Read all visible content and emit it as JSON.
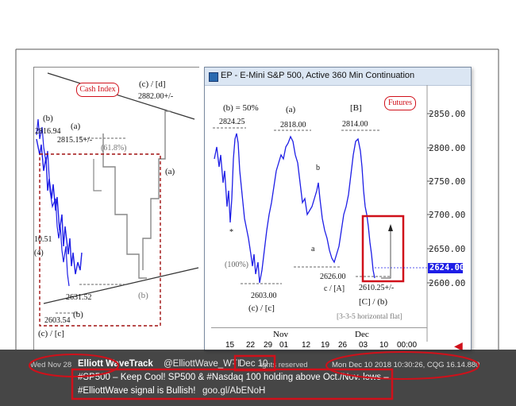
{
  "left_chart": {
    "cash_index_label": "Cash Index",
    "cd_label": "(c) / [d]",
    "cd_value": "2882.00+/-",
    "b_label": "(b)",
    "b_value": "2816.94",
    "a_label": "(a)",
    "a_value": "2815.15+/-",
    "fib_label": "(61.8%)",
    "left_value": "10.51",
    "left_4_label": "(4)",
    "low_value": "2631.52",
    "low_b_label": "(b)",
    "bottom_value": "2603.54",
    "bottom_label": "(c) / [c]",
    "right_b_label": "(b)",
    "right_a_label": "(a)",
    "date_fragment": "Wed Nov 28"
  },
  "window": {
    "title": "EP - E-Mini S&P 500, Active 360 Min Continuation",
    "futures_label": "Futures",
    "annotations": {
      "b50": "(b)  = 50%",
      "b50_value": "2824.25",
      "a": "(a)",
      "a_value": "2818.00",
      "B": "[B]",
      "B_value": "2814.00",
      "b_small": "b",
      "a_small": "a",
      "star": "*",
      "pct100": "(100%)",
      "low1_value": "2603.00",
      "low1_label": "(c) / [c]",
      "mid_value": "2626.00",
      "mid_label": "c / [A]",
      "right_value": "2610.25+/-",
      "right_label": "[C] / (b)",
      "flat_note": "[3-3-5 horizontal flat]"
    },
    "price_axis": [
      "2850.00",
      "2800.00",
      "2750.00",
      "2700.00",
      "2650.00",
      "2600.00"
    ],
    "current_price": "2624.00",
    "month_labels": [
      "Nov",
      "Dec"
    ],
    "day_labels": [
      "15",
      "22",
      "29",
      "01",
      "12",
      "19",
      "26",
      "03",
      "10"
    ],
    "time_label": "00:00",
    "status": "Mon Dec 10 2018 10:30:26, CQG 16.14.880",
    "rights": "ights reserved"
  },
  "tweet": {
    "author": "Elliott WaveTrack",
    "handle": "@ElliottWave_WTI",
    "separator": "·",
    "date": "Dec 10",
    "line1": "#SP500 – Keep Cool!  SP500 & #Nasdaq 100 holding above Oct./Nov. lows –",
    "line2_a": "#ElliottWave signal is Bullish!",
    "line2_link": "goo.gl/AbENoH"
  },
  "colors": {
    "price_line": "#1e1ee6",
    "annotation_red": "#d0101a",
    "overlay": "#282828",
    "title_bar": "#dbe6f3"
  }
}
